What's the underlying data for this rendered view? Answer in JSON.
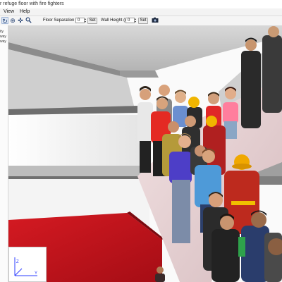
{
  "window": {
    "title": "r refuge floor with fire fighters"
  },
  "menu": {
    "items": [
      "View",
      "Help"
    ]
  },
  "toolbar": {
    "tools": [
      {
        "icon": "rotate-view-icon",
        "glyph": "↻",
        "active": true
      },
      {
        "icon": "zoom-icon",
        "glyph": "⊕",
        "active": false
      },
      {
        "icon": "pan-icon",
        "glyph": "✜",
        "active": false
      },
      {
        "icon": "magnifier-icon",
        "glyph": "⚲",
        "active": false
      }
    ],
    "floor_separation": {
      "label": "Floor Separation (m):",
      "value": "0",
      "set_label": "Set"
    },
    "wall_height": {
      "label": "Wall Height (m):",
      "value": "0",
      "set_label": "Set"
    },
    "camera_icon": "camera-icon"
  },
  "sidebar": {
    "items": [
      "ity",
      "way",
      "way"
    ]
  },
  "axes": {
    "z": "Z",
    "y": "Y",
    "x": "X"
  },
  "scene": {
    "description_icon": "3d-scene-viewport",
    "colors": {
      "floor_red": "#c8141e",
      "ceiling_grey": "#c8c8c8",
      "ramp_pink": "#e9d3d5"
    }
  }
}
